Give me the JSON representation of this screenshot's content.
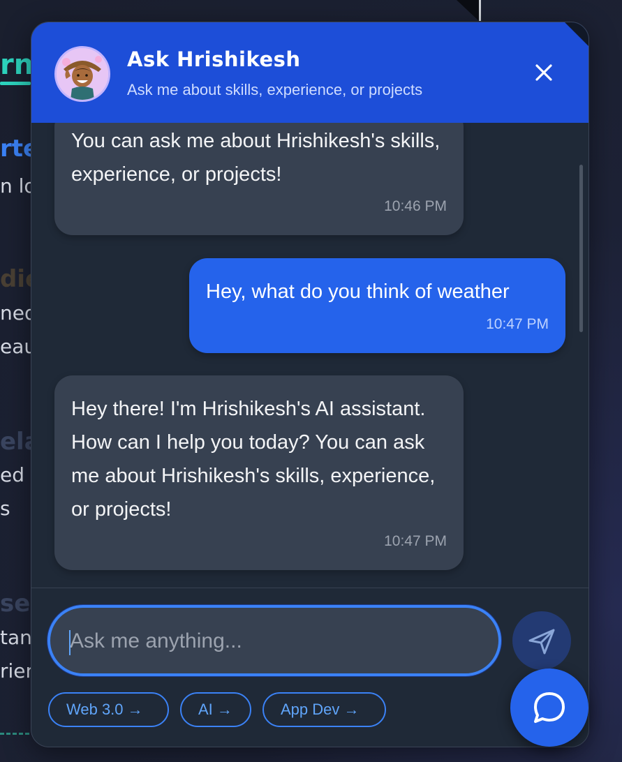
{
  "background": {
    "fragments": [
      "rne",
      "rte",
      "n lov",
      "die",
      "ned",
      "eau",
      "ela",
      "ed",
      "s",
      "se",
      "tan",
      "rien"
    ]
  },
  "chat": {
    "header": {
      "title": "Ask Hrishikesh",
      "subtitle": "Ask me about skills, experience, or projects"
    },
    "messages": [
      {
        "sender": "bot",
        "text": "You can ask me about Hrishikesh's skills, experience, or projects!",
        "time": "10:46 PM"
      },
      {
        "sender": "user",
        "text": "Hey, what do you think of weather",
        "time": "10:47 PM"
      },
      {
        "sender": "bot",
        "text": "Hey there! I'm Hrishikesh's AI assistant. How can I help you today? You can ask me about Hrishikesh's skills, experience, or projects!",
        "time": "10:47 PM"
      }
    ],
    "input": {
      "placeholder": "Ask me anything...",
      "value": ""
    },
    "chips": [
      "Web 3.0 →",
      "AI →",
      "App Dev →"
    ]
  },
  "colors": {
    "header": "#1d4ed8",
    "panel": "#1f2937",
    "bot_bubble": "#374151",
    "user_bubble": "#2563eb",
    "accent": "#3b82f6"
  },
  "icons": {
    "close": "close-icon",
    "send": "send-icon",
    "chat": "chat-bubble-icon"
  }
}
